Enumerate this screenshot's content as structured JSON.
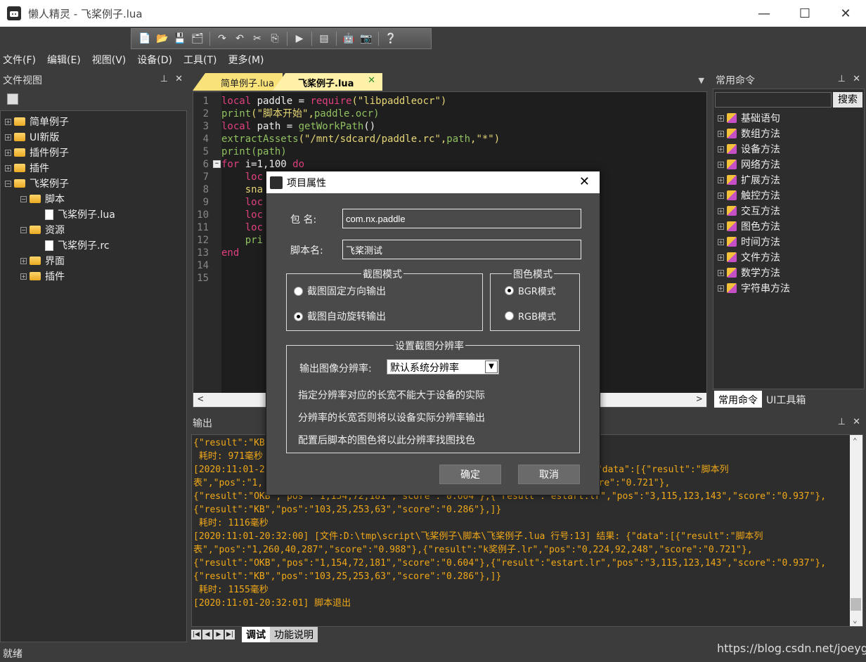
{
  "window": {
    "title": "懒人精灵 - 飞桨例子.lua"
  },
  "menu": [
    "文件(F)",
    "编辑(E)",
    "视图(V)",
    "设备(D)",
    "工具(T)",
    "更多(M)"
  ],
  "file_view": {
    "title": "文件视图",
    "items": [
      {
        "label": "简单例子",
        "type": "folder",
        "exp": "+",
        "indent": 0
      },
      {
        "label": "UI新版",
        "type": "folder",
        "exp": "+",
        "indent": 0
      },
      {
        "label": "插件例子",
        "type": "folder",
        "exp": "+",
        "indent": 0
      },
      {
        "label": "插件",
        "type": "folder",
        "exp": "+",
        "indent": 0
      },
      {
        "label": "飞桨例子",
        "type": "folder",
        "exp": "−",
        "indent": 0
      },
      {
        "label": "脚本",
        "type": "folder",
        "exp": "−",
        "indent": 1
      },
      {
        "label": "飞桨例子.lua",
        "type": "file",
        "exp": "",
        "indent": 2
      },
      {
        "label": "资源",
        "type": "folder",
        "exp": "−",
        "indent": 1
      },
      {
        "label": "飞桨例子.rc",
        "type": "file",
        "exp": "",
        "indent": 2
      },
      {
        "label": "界面",
        "type": "folder",
        "exp": "+",
        "indent": 1
      },
      {
        "label": "插件",
        "type": "folder",
        "exp": "+",
        "indent": 1
      }
    ]
  },
  "editor": {
    "tabs": [
      "简单例子.lua",
      "飞桨例子.lua"
    ],
    "line_numbers": [
      "1",
      "2",
      "3",
      "4",
      "5",
      "6",
      "7",
      "8",
      "9",
      "10",
      "11",
      "12",
      "13",
      "14",
      "15"
    ],
    "fold_marker": "−",
    "lines": [
      [
        {
          "t": "local ",
          "c": "kw"
        },
        {
          "t": "paddle = ",
          "c": ""
        },
        {
          "t": "require",
          "c": "kw"
        },
        {
          "t": "(\"libpaddleocr\")",
          "c": "str"
        }
      ],
      [
        {
          "t": "print",
          "c": "fn"
        },
        {
          "t": "(\"脚本开始\",",
          "c": "str"
        },
        {
          "t": "paddle.ocr)",
          "c": "fn"
        }
      ],
      [
        {
          "t": "local ",
          "c": "kw"
        },
        {
          "t": "path = ",
          "c": ""
        },
        {
          "t": "getWorkPath",
          "c": "fn"
        },
        {
          "t": "()",
          "c": ""
        }
      ],
      [
        {
          "t": "extractAssets",
          "c": "fn"
        },
        {
          "t": "(\"/mnt/sdcard/paddle.rc\",",
          "c": "str"
        },
        {
          "t": "path",
          "c": "fn"
        },
        {
          "t": ",\"*\")",
          "c": "str"
        }
      ],
      [
        {
          "t": "print",
          "c": "fn"
        },
        {
          "t": "(path)",
          "c": "fn"
        }
      ],
      [
        {
          "t": "for ",
          "c": "kw"
        },
        {
          "t": "i=1,100 ",
          "c": ""
        },
        {
          "t": "do",
          "c": "kw"
        }
      ],
      [
        {
          "t": "    loc",
          "c": "kw"
        }
      ],
      [
        {
          "t": "    sna",
          "c": "str"
        }
      ],
      [
        {
          "t": "    loc",
          "c": "kw"
        }
      ],
      [
        {
          "t": "    loc",
          "c": "kw"
        }
      ],
      [
        {
          "t": "    loc",
          "c": "kw"
        }
      ],
      [
        {
          "t": "    pri",
          "c": "fn"
        }
      ],
      [
        {
          "t": "end",
          "c": "kw"
        }
      ],
      [],
      []
    ]
  },
  "commands": {
    "title": "常用命令",
    "search_btn": "搜索",
    "items": [
      "基础语句",
      "数组方法",
      "设备方法",
      "网络方法",
      "扩展方法",
      "触控方法",
      "交互方法",
      "图色方法",
      "时间方法",
      "文件方法",
      "数学方法",
      "字符串方法"
    ],
    "bottom_tabs": [
      "常用命令",
      "UI工具箱"
    ]
  },
  "output": {
    "title": "输出",
    "lines": [
      "{\"result\":\"KB",
      " 耗时: 971毫秒",
      "[2020:11:01-2                                                  13] 结果: {\"data\":[{\"result\":\"脚本列",
      "表\",\"pos\":\"1,                                            ,224,92,248\",\"score\":\"0.721\"},",
      "{\"result\":\"OKB\",\"pos\":\"1,154,72,181\",\"score\":\"0.604\"},{\"result\":\"estart.lr\",\"pos\":\"3,115,123,143\",\"score\":\"0.937\"},",
      "{\"result\":\"KB\",\"pos\":\"103,25,253,63\",\"score\":\"0.286\"},]}",
      " 耗时: 1116毫秒",
      "[2020:11:01-20:32:00] [文件:D:\\tmp\\script\\飞桨例子\\脚本\\飞桨例子.lua 行号:13] 结果: {\"data\":[{\"result\":\"脚本列",
      "表\",\"pos\":\"1,260,40,287\",\"score\":\"0.988\"},{\"result\":\"k奖例子.lr\",\"pos\":\"0,224,92,248\",\"score\":\"0.721\"},",
      "{\"result\":\"OKB\",\"pos\":\"1,154,72,181\",\"score\":\"0.604\"},{\"result\":\"estart.lr\",\"pos\":\"3,115,123,143\",\"score\":\"0.937\"},",
      "{\"result\":\"KB\",\"pos\":\"103,25,253,63\",\"score\":\"0.286\"},]}",
      " 耗时: 1155毫秒",
      "[2020:11:01-20:32:01] 脚本退出"
    ],
    "tabs": [
      "调试",
      "功能说明"
    ]
  },
  "status": {
    "text": "就绪",
    "watermark": "https://blog.csdn.net/joeygoo"
  },
  "dialog": {
    "title": "项目属性",
    "package_label": "包 名:",
    "package_value": "com.nx.paddle",
    "script_label": "脚本名:",
    "script_value": "飞桨测试",
    "capture_group": "截图模式",
    "capture_opt1": "截图固定方向输出",
    "capture_opt2": "截图自动旋转输出",
    "color_group": "图色模式",
    "color_opt1": "BGR模式",
    "color_opt2": "RGB模式",
    "res_group": "设置截图分辨率",
    "res_label": "输出图像分辨率:",
    "res_value": "默认系统分辨率",
    "res_note1": "指定分辨率对应的长宽不能大于设备的实际",
    "res_note2": "分辨率的长宽否则将以设备实际分辨率输出",
    "res_note3": "配置后脚本的图色将以此分辨率找图找色",
    "ok": "确定",
    "cancel": "取消"
  }
}
